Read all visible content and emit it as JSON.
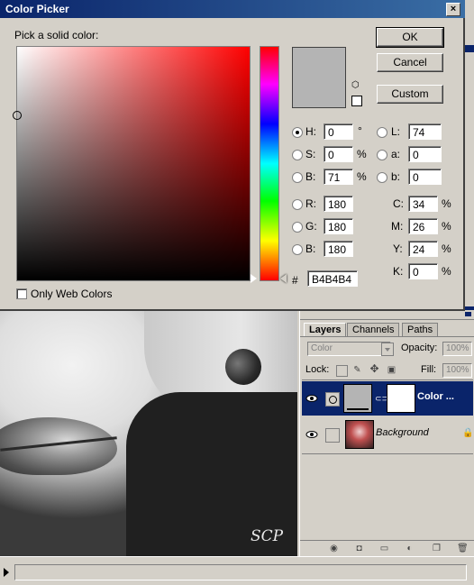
{
  "dialog": {
    "title": "Color Picker",
    "close_label": "×",
    "prompt": "Pick a solid color:",
    "buttons": {
      "ok": "OK",
      "cancel": "Cancel",
      "custom": "Custom"
    },
    "current_color_hex": "#b4b4b4",
    "hsb": {
      "h_label": "H:",
      "h_value": "0",
      "h_unit": "°",
      "s_label": "S:",
      "s_value": "0",
      "s_unit": "%",
      "b_label": "B:",
      "b_value": "71",
      "b_unit": "%"
    },
    "rgb": {
      "r_label": "R:",
      "r_value": "180",
      "g_label": "G:",
      "g_value": "180",
      "b_label": "B:",
      "b_value": "180"
    },
    "lab": {
      "l_label": "L:",
      "l_value": "74",
      "a_label": "a:",
      "a_value": "0",
      "b_label": "b:",
      "b_value": "0"
    },
    "cmyk": {
      "c_label": "C:",
      "c_value": "34",
      "m_label": "M:",
      "m_value": "26",
      "y_label": "Y:",
      "y_value": "24",
      "k_label": "K:",
      "k_value": "0",
      "unit": "%"
    },
    "hex_label": "#",
    "hex_value": "B4B4B4",
    "web_colors_label": "Only Web Colors",
    "web_colors_checked": false,
    "selected_mode": "H"
  },
  "layers": {
    "tabs": [
      "Layers",
      "Channels",
      "Paths"
    ],
    "active_tab": "Layers",
    "blend_mode": "Color",
    "opacity_label": "Opacity:",
    "opacity_value": "100%",
    "lock_label": "Lock:",
    "fill_label": "Fill:",
    "fill_value": "100%",
    "items": [
      {
        "name": "Color ...",
        "selected": true
      },
      {
        "name": "Background",
        "selected": false
      }
    ]
  },
  "photo": {
    "signature": "SCP"
  },
  "icons": [
    "close-icon",
    "eye-icon",
    "link-icon",
    "lock-icon",
    "cube-icon",
    "move-icon",
    "brush-icon",
    "trash-icon",
    "new-layer-icon",
    "folder-icon",
    "mask-icon",
    "fx-icon",
    "adjustment-icon",
    "play-icon"
  ],
  "colors": {
    "titlebar": "#0a246a",
    "selected_row": "#0a246a",
    "dialog_bg": "#d4d0c8"
  }
}
